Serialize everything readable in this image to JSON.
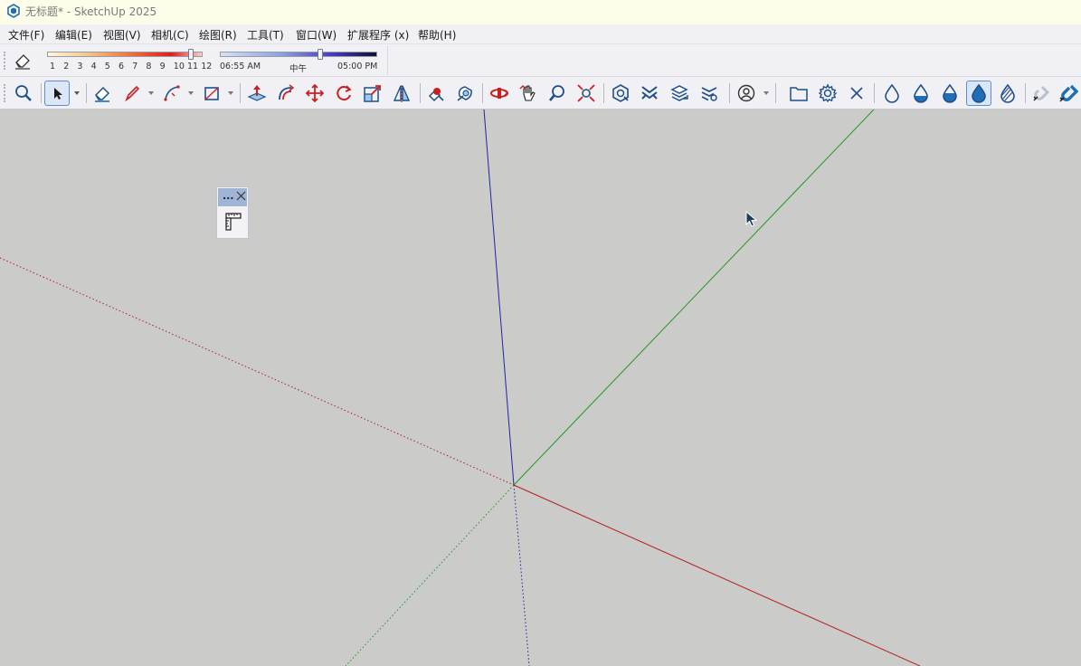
{
  "window": {
    "title": "无标题* - SketchUp 2025"
  },
  "menu": {
    "items": [
      "文件(F)",
      "编辑(E)",
      "视图(V)",
      "相机(C)",
      "绘图(R)",
      "工具(T)",
      "窗口(W)",
      "扩展程序 (x)",
      "帮助(H)"
    ]
  },
  "shadows": {
    "months": [
      "1",
      "2",
      "3",
      "4",
      "5",
      "6",
      "7",
      "8",
      "9",
      "10",
      "11",
      "12"
    ],
    "month_value": 11,
    "time_start": "06:55 AM",
    "time_mid": "中午",
    "time_end": "05:00 PM",
    "time_value_fraction": 0.64
  },
  "toolbar": {
    "icons": [
      "zoom-window-icon",
      "select-icon",
      "eraser-icon",
      "pencil-line-icon",
      "arc-icon",
      "rectangle-icon",
      "push-pull-icon",
      "offset-icon",
      "move-icon",
      "rotate-icon",
      "scale-icon",
      "section-icon",
      "paint-icon",
      "tape-icon",
      "orbit-icon",
      "pan-icon",
      "zoom-icon",
      "zoom-extents-icon",
      "warehouse-icon",
      "extension-icon",
      "layers-icon",
      "layers-settings-icon",
      "account-icon",
      "folder-icon",
      "gear-icon",
      "close-icon",
      "drop-empty-icon",
      "drop-half-icon",
      "drop-most-icon",
      "drop-full-icon",
      "drop-striped-icon",
      "magnet-off-icon",
      "magnet-icon"
    ]
  },
  "colors": {
    "accent": "#1f6fb4",
    "axis_red": "#b32020",
    "axis_green": "#1e9a1e",
    "axis_blue": "#2222aa",
    "viewport_bg": "#cbcbc9"
  },
  "float_panel": {
    "dots": "..."
  }
}
